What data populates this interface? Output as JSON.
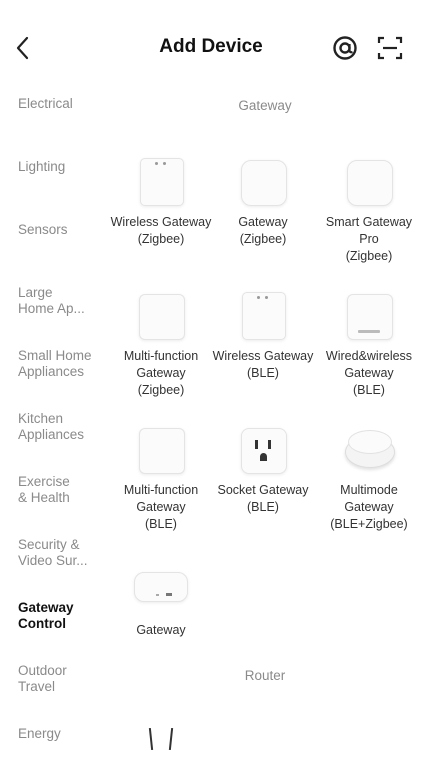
{
  "header": {
    "title": "Add Device",
    "back_icon": "chevron-left-icon",
    "right_icons": [
      "at-sign-icon",
      "scan-icon"
    ]
  },
  "sidebar": {
    "items": [
      {
        "label": "Electrical",
        "active": false
      },
      {
        "label": "Lighting",
        "active": false
      },
      {
        "label": "Sensors",
        "active": false
      },
      {
        "label": "Large\nHome Ap...",
        "active": false
      },
      {
        "label": "Small Home\nAppliances",
        "active": false
      },
      {
        "label": "Kitchen\nAppliances",
        "active": false
      },
      {
        "label": "Exercise\n& Health",
        "active": false
      },
      {
        "label": "Security &\nVideo Sur...",
        "active": false
      },
      {
        "label": "Gateway\nControl",
        "active": true
      },
      {
        "label": "Outdoor\nTravel",
        "active": false
      },
      {
        "label": "Energy",
        "active": false
      }
    ]
  },
  "content": {
    "sections": [
      {
        "title": "Gateway"
      },
      {
        "title": "Router"
      }
    ],
    "devices": [
      {
        "label": "Wireless Gateway\n(Zigbee)",
        "icon": "tall-gateway-icon"
      },
      {
        "label": "Gateway\n(Zigbee)",
        "icon": "square-gateway-icon"
      },
      {
        "label": "Smart Gateway\nPro\n(Zigbee)",
        "icon": "square-gateway-icon"
      },
      {
        "label": "Multi-function\nGateway\n(Zigbee)",
        "icon": "square-gateway-icon"
      },
      {
        "label": "Wireless Gateway\n(BLE)",
        "icon": "tall-gateway-icon"
      },
      {
        "label": "Wired&wireless\nGateway\n(BLE)",
        "icon": "wired-gateway-icon"
      },
      {
        "label": "Multi-function\nGateway\n(BLE)",
        "icon": "square-gateway-icon"
      },
      {
        "label": "Socket Gateway\n(BLE)",
        "icon": "socket-icon"
      },
      {
        "label": "Multimode\nGateway\n(BLE+Zigbee)",
        "icon": "round-hub-icon"
      },
      {
        "label": "Gateway",
        "icon": "flat-hub-icon"
      },
      {
        "label": "",
        "icon": "router-icon"
      }
    ]
  }
}
